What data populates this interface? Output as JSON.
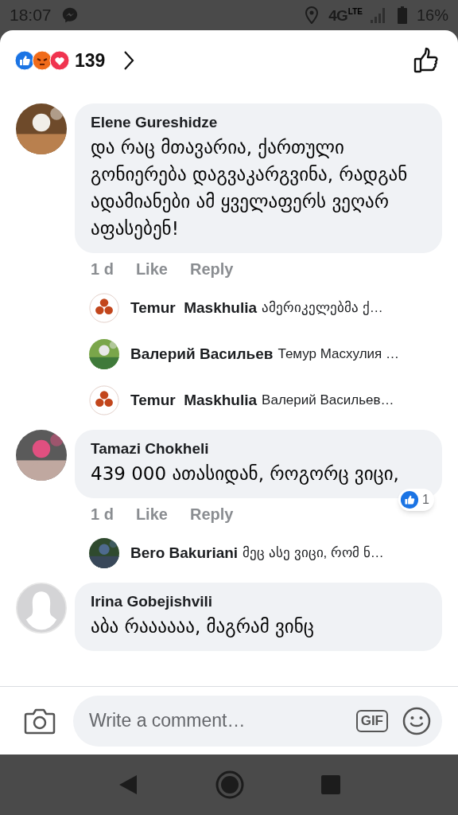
{
  "status_bar": {
    "time": "18:07",
    "network": "4G",
    "network_sub": "LTE",
    "battery": "16%"
  },
  "reactions": {
    "count": "139"
  },
  "comments": [
    {
      "author": "Elene Gureshidze",
      "text": "და რაც მთავარია, ქართული გონიერება დაგვაკარგვინა, რადგან ადამიანები ამ ყველაფერს ვეღარ აფასებენ!",
      "meta": {
        "time": "1 d",
        "like": "Like",
        "reply": "Reply"
      },
      "replies": [
        {
          "author": "Temur  Maskhulia",
          "kind": "logo",
          "text": "ამერიკელებმა ქ…"
        },
        {
          "author": "Валерий Васильев",
          "text": "Темур Масхулия …"
        },
        {
          "author": "Temur  Maskhulia",
          "kind": "logo",
          "text": "Валерий Васильев…"
        }
      ]
    },
    {
      "author": "Tamazi Chokheli",
      "text": "439 000 ათასიდან, როგორც ვიცი,",
      "meta": {
        "time": "1 d",
        "like": "Like",
        "reply": "Reply"
      },
      "reaction_count": "1",
      "replies": [
        {
          "author": "Bero Bakuriani",
          "text": "მეც ასე ვიცი, რომ ნ…"
        }
      ]
    },
    {
      "author": "Irina Gobejishvili",
      "kind": "default",
      "text": "აბა რაააააა, მაგრამ ვინც"
    }
  ],
  "composer": {
    "placeholder": "Write a comment…",
    "gif": "GIF"
  }
}
